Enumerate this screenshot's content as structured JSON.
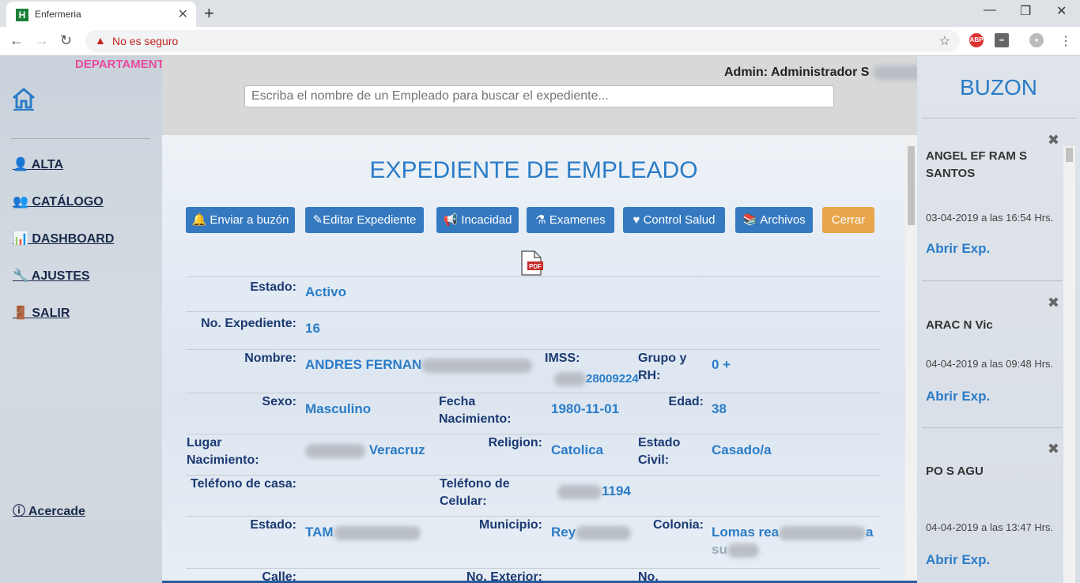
{
  "browser": {
    "tab_title": "Enfermeria",
    "security_text": "No es seguro",
    "ext_abp": "ABP"
  },
  "sidebar": {
    "department": "DEPARTAMENTO DE ENFERMERIA",
    "items": [
      {
        "label": "ALTA",
        "icon": "user-icon"
      },
      {
        "label": "CATÁLOGO",
        "icon": "users-icon"
      },
      {
        "label": "DASHBOARD",
        "icon": "chart-icon"
      },
      {
        "label": "AJUSTES",
        "icon": "wrench-icon"
      },
      {
        "label": "SALIR",
        "icon": "exit-icon"
      }
    ],
    "about": "Acercade"
  },
  "header": {
    "admin": "Admin: Administrador S",
    "search_placeholder": "Escriba el nombre de un Empleado para buscar el expediente..."
  },
  "record": {
    "title": "EXPEDIENTE DE EMPLEADO",
    "buttons": [
      "Enviar a buzón",
      "Editar Expediente",
      "Incacidad",
      "Examenes",
      "Control Salud",
      "Archivos",
      "Cerrar"
    ],
    "pdf_label": "PDF",
    "fields": {
      "estado_label": "Estado:",
      "estado": "Activo",
      "expediente_label": "No. Expediente:",
      "expediente": "16",
      "nombre_label": "Nombre:",
      "nombre": "ANDRES FERNAN",
      "imss_label": "IMSS:",
      "imss": "28009224",
      "grupo_label": "Grupo y RH:",
      "grupo": "0 +",
      "sexo_label": "Sexo:",
      "sexo": "Masculino",
      "fecha_label": "Fecha Nacimiento:",
      "fecha": "1980-11-01",
      "edad_label": "Edad:",
      "edad": "38",
      "lugar_label": "Lugar Nacimiento:",
      "lugar": "Veracruz",
      "religion_label": "Religion:",
      "religion": "Catolica",
      "civil_label": "Estado Civil:",
      "civil": "Casado/a",
      "tel_casa_label": "Teléfono de casa:",
      "tel_cel_label": "Teléfono de Celular:",
      "tel_cel": "1194",
      "estado2_label": "Estado:",
      "estado2": "TAM",
      "municipio_label": "Municipio:",
      "municipio": "Rey",
      "colonia_label": "Colonia:",
      "colonia": "Lomas rea",
      "colonia2": "a",
      "colonia3": "su",
      "calle_label": "Calle:",
      "exterior_label": "No. Exterior:",
      "no_label": "No."
    }
  },
  "buzon": {
    "title": "BUZON",
    "cards": [
      {
        "name": "ANGEL EF RAM S SANTOS",
        "date": "03-04-2019 a las 16:54 Hrs.",
        "link": "Abrir Exp."
      },
      {
        "name": "ARAC N Vic",
        "date": "04-04-2019 a las 09:48 Hrs.",
        "link": "Abrir Exp."
      },
      {
        "name": "PO S AGU",
        "date": "04-04-2019 a las 13:47 Hrs.",
        "link": "Abrir Exp."
      }
    ]
  }
}
